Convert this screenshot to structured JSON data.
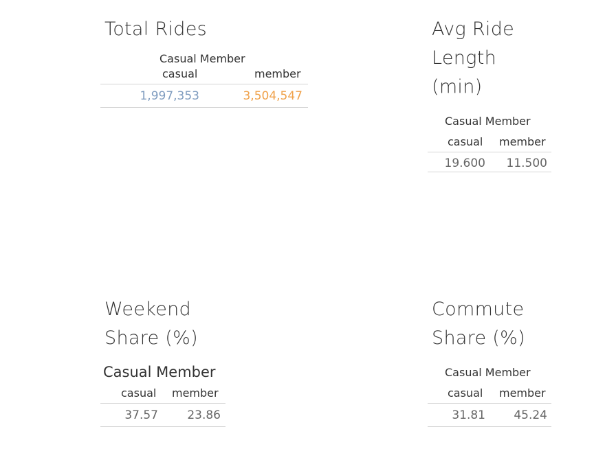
{
  "colors": {
    "casual": "#7f9cbf",
    "member": "#f0a24b",
    "text": "#333333",
    "muted": "#666666",
    "rule": "#d4d4d4"
  },
  "panels": {
    "total_rides": {
      "title": "Total Rides",
      "group_header": "Casual Member",
      "columns": [
        "casual",
        "member"
      ],
      "values": [
        "1,997,353",
        "3,504,547"
      ]
    },
    "avg_ride_length": {
      "title_lines": [
        "Avg Ride",
        "Length",
        "(min)"
      ],
      "group_header": "Casual Member",
      "columns": [
        "casual",
        "member"
      ],
      "values": [
        "19.600",
        "11.500"
      ]
    },
    "weekend_share": {
      "title_lines": [
        "Weekend",
        "Share (%)"
      ],
      "group_header": "Casual Member",
      "columns": [
        "casual",
        "member"
      ],
      "values": [
        "37.57",
        "23.86"
      ]
    },
    "commute_share": {
      "title_lines": [
        "Commute",
        "Share (%)"
      ],
      "group_header": "Casual Member",
      "columns": [
        "casual",
        "member"
      ],
      "values": [
        "31.81",
        "45.24"
      ]
    }
  }
}
